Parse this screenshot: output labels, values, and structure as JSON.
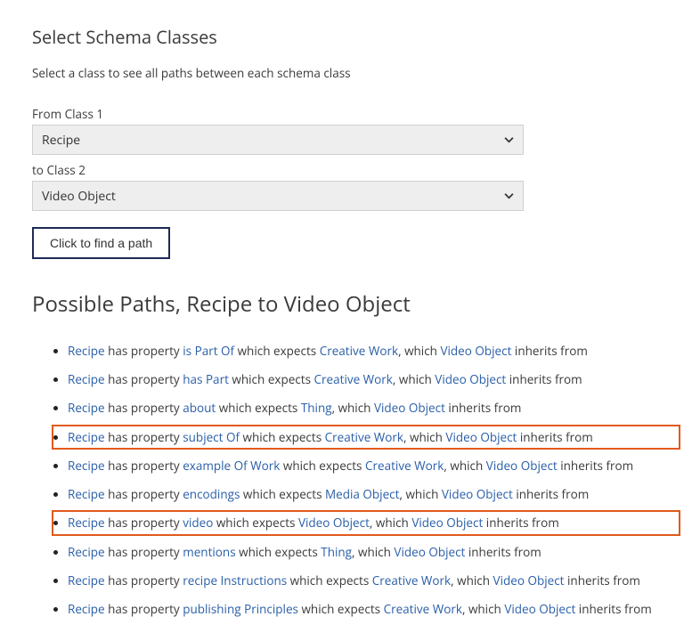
{
  "heading": "Select Schema Classes",
  "intro": "Select a class to see all paths between each schema class",
  "form": {
    "fromLabel": "From Class 1",
    "fromValue": "Recipe",
    "toLabel": "to Class 2",
    "toValue": "Video Object",
    "buttonLabel": "Click to find a path"
  },
  "resultsHeading": "Possible Paths, Recipe to Video Object",
  "txt": {
    "hasProperty": " has property ",
    "whichExpects": " which expects ",
    "commaWhich": ", which ",
    "inheritsFrom": " inherits from"
  },
  "paths": [
    {
      "start": "Recipe",
      "property": "is Part Of",
      "expects": "Creative Work",
      "inherit": "Video Object",
      "highlight": false
    },
    {
      "start": "Recipe",
      "property": "has Part",
      "expects": "Creative Work",
      "inherit": "Video Object",
      "highlight": false
    },
    {
      "start": "Recipe",
      "property": "about",
      "expects": "Thing",
      "inherit": "Video Object",
      "highlight": false
    },
    {
      "start": "Recipe",
      "property": "subject Of",
      "expects": "Creative Work",
      "inherit": "Video Object",
      "highlight": true
    },
    {
      "start": "Recipe",
      "property": "example Of Work",
      "expects": "Creative Work",
      "inherit": "Video Object",
      "highlight": false
    },
    {
      "start": "Recipe",
      "property": "encodings",
      "expects": "Media Object",
      "inherit": "Video Object",
      "highlight": false
    },
    {
      "start": "Recipe",
      "property": "video",
      "expects": "Video Object",
      "inherit": "Video Object",
      "highlight": true
    },
    {
      "start": "Recipe",
      "property": "mentions",
      "expects": "Thing",
      "inherit": "Video Object",
      "highlight": false
    },
    {
      "start": "Recipe",
      "property": "recipe Instructions",
      "expects": "Creative Work",
      "inherit": "Video Object",
      "highlight": false
    },
    {
      "start": "Recipe",
      "property": "publishing Principles",
      "expects": "Creative Work",
      "inherit": "Video Object",
      "highlight": false
    }
  ]
}
